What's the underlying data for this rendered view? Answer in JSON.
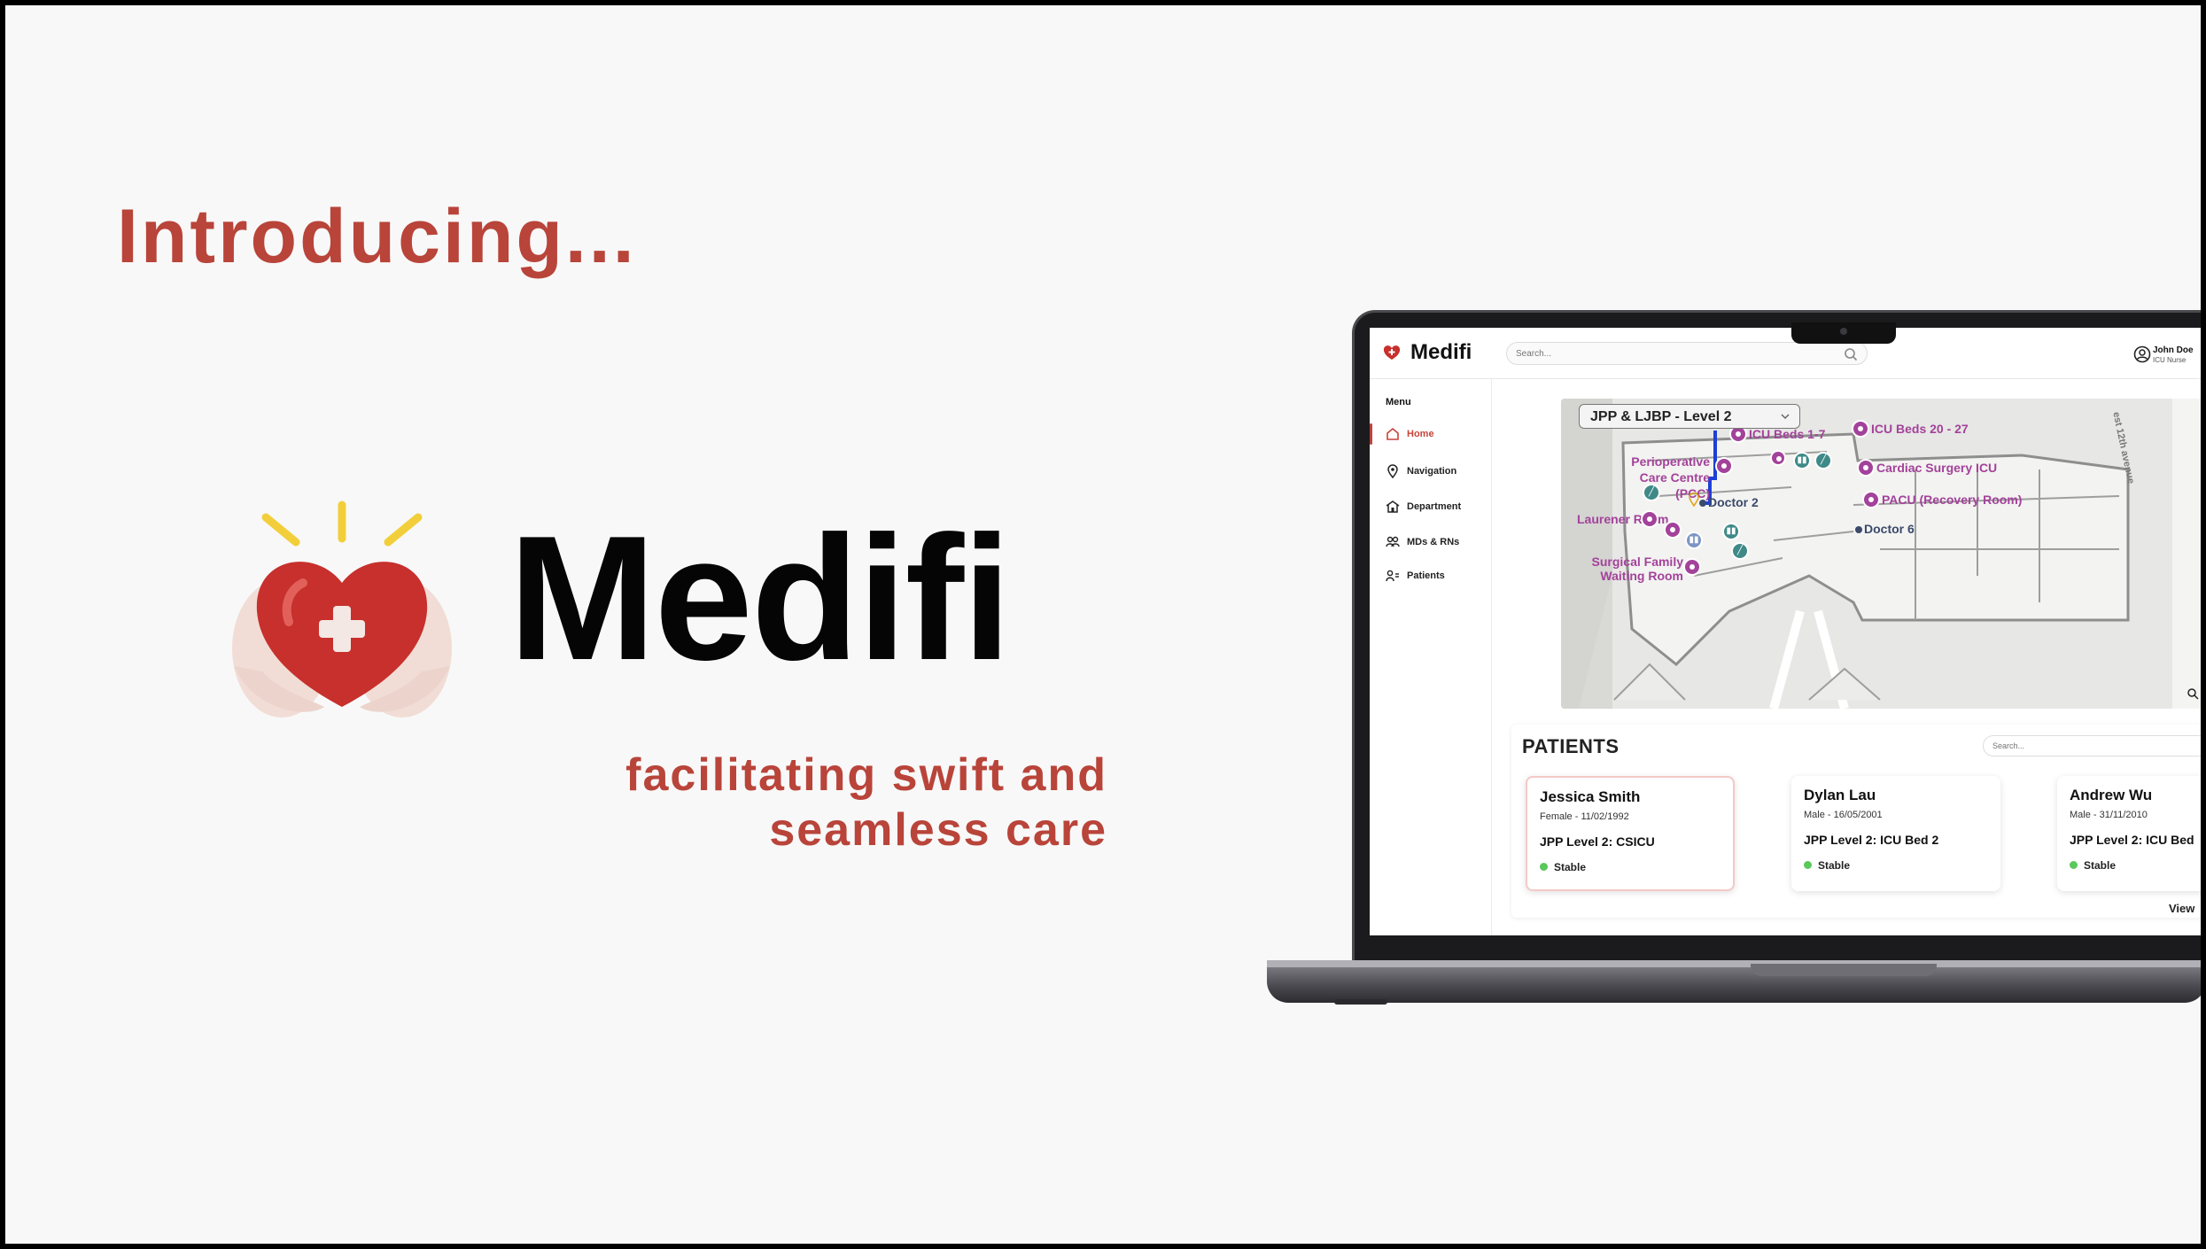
{
  "intro": "Introducing...",
  "brand": "Medifi",
  "tagline": [
    "facilitating swift and",
    "seamless care"
  ],
  "colors": {
    "accent": "#b9443a",
    "poi": "#a3429a",
    "route": "#1d3fd8",
    "status_ok": "#5ac85a"
  },
  "app": {
    "title": "Medifi",
    "search_placeholder": "Search...",
    "user": {
      "name": "John Doe",
      "role": "ICU Nurse"
    },
    "menu_title": "Menu",
    "nav": [
      {
        "label": "Home",
        "icon": "home-icon",
        "active": true
      },
      {
        "label": "Navigation",
        "icon": "location-pin-icon",
        "active": false
      },
      {
        "label": "Department",
        "icon": "building-icon",
        "active": false
      },
      {
        "label": "MDs & RNs",
        "icon": "staff-icon",
        "active": false
      },
      {
        "label": "Patients",
        "icon": "patients-icon",
        "active": false
      }
    ],
    "map": {
      "floor": "JPP & LJBP - Level 2",
      "street": "est 12th avenue",
      "pois": [
        "ICU Beds 1-7",
        "ICU Beds 20 - 27",
        "Perioperative Care Centre (PCC)",
        "Cardiac Surgery ICU",
        "PACU (Recovery Room)",
        "Laurener Room",
        "Surgical Family Waiting Room"
      ],
      "doctors": [
        "Doctor 2",
        "Doctor 6"
      ]
    },
    "patients": {
      "title": "PATIENTS",
      "search_placeholder": "Search...",
      "view_all": "View",
      "list": [
        {
          "name": "Jessica Smith",
          "meta": "Female - 11/02/1992",
          "location": "JPP Level 2: CSICU",
          "status": "Stable"
        },
        {
          "name": "Dylan Lau",
          "meta": "Male - 16/05/2001",
          "location": "JPP Level 2: ICU Bed 2",
          "status": "Stable"
        },
        {
          "name": "Andrew Wu",
          "meta": "Male - 31/11/2010",
          "location": "JPP Level 2: ICU Bed",
          "status": "Stable"
        }
      ]
    }
  }
}
